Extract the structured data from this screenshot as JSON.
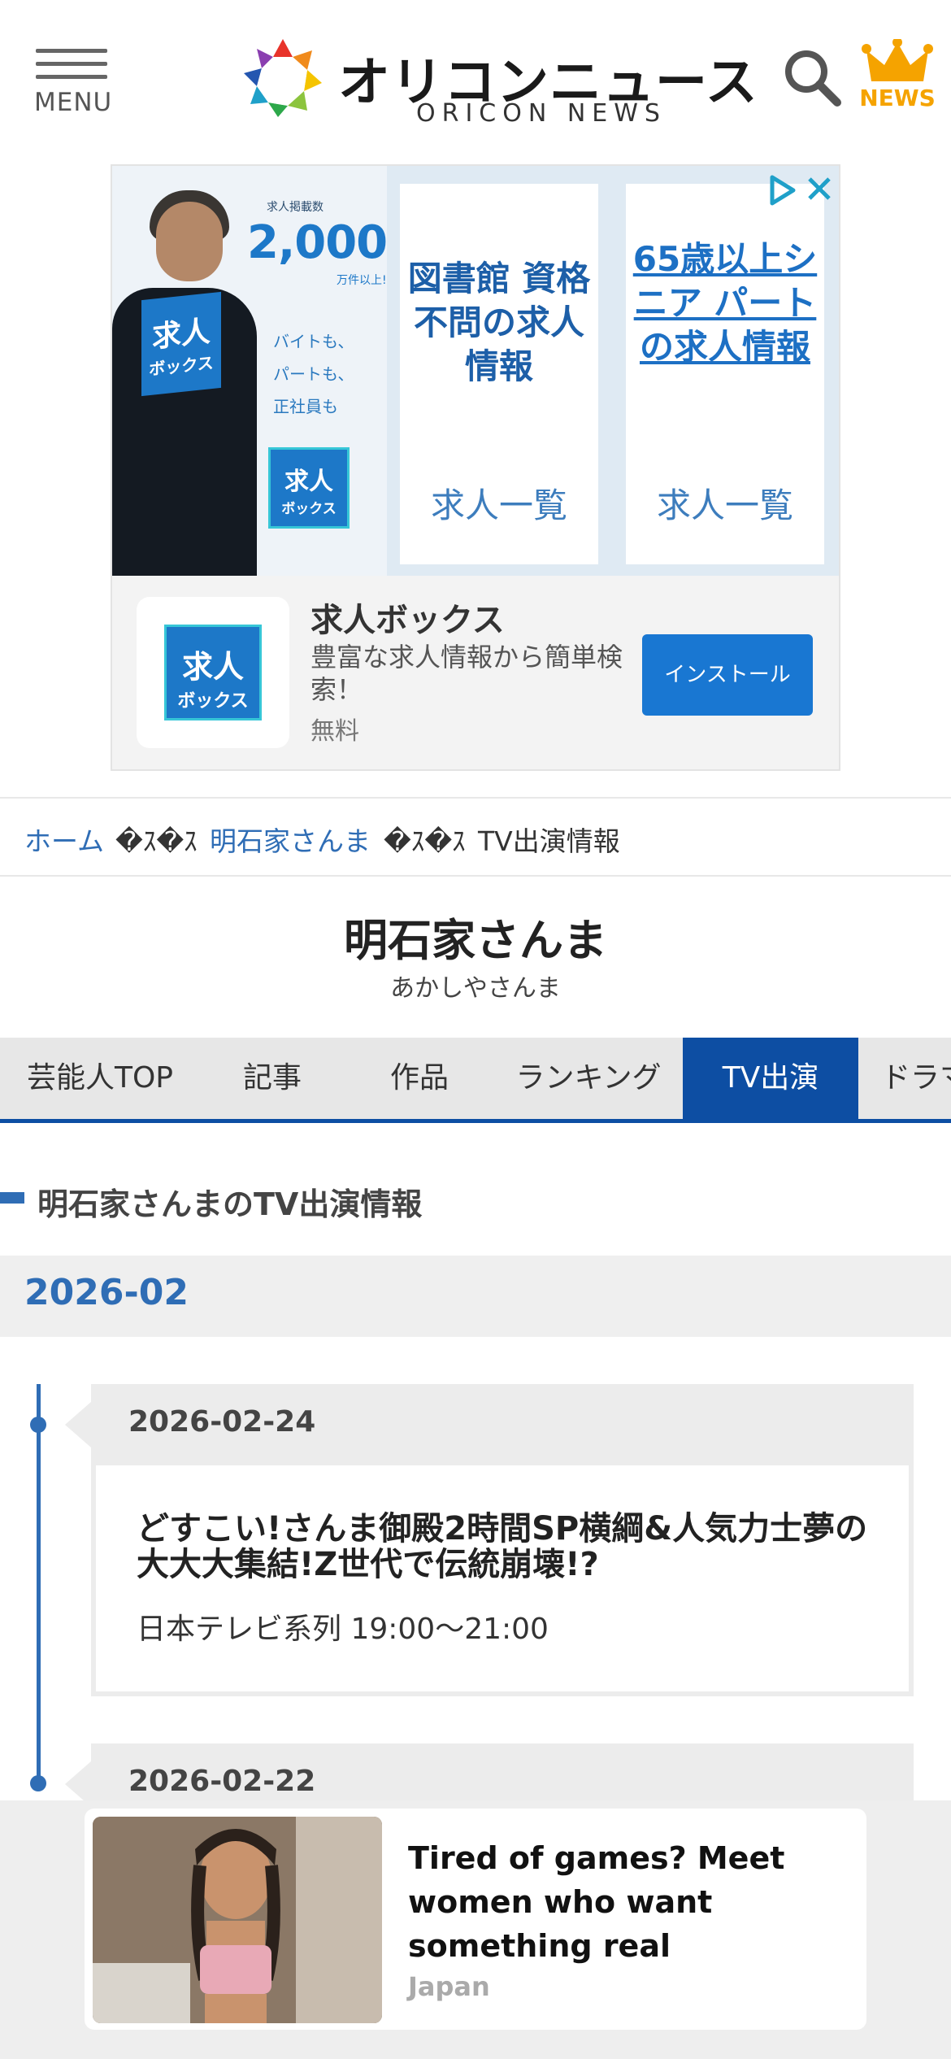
{
  "header": {
    "menu_label": "MENU",
    "logo_text": "オリコンニュース",
    "logo_subtext": "ORICON NEWS",
    "news_label": "NEWS"
  },
  "ad": {
    "count_label": "求人掲載数",
    "count": "2,000",
    "count_unit": "万件以上!",
    "bullets": [
      "バイトも、",
      "パートも、",
      "正社員も"
    ],
    "box_text": "求人\nボックス",
    "card1_head": "図書館 資格不問の求人情報",
    "card1_foot": "求人一覧",
    "card2_head": "65歳以上シニア パートの求人情報",
    "card2_foot": "求人一覧",
    "app_name": "求人ボックス",
    "app_desc": "豊富な求人情報から簡単検索！",
    "app_price": "無料",
    "install_label": "インストール"
  },
  "breadcrumb": {
    "home": "ホーム",
    "sep": "�ｽ�ｽ",
    "artist": "明石家さんま",
    "current": "TV出演情報"
  },
  "profile": {
    "name": "明石家さんま",
    "kana": "あかしやさんま"
  },
  "tabs": [
    "芸能人TOP",
    "記事",
    "作品",
    "ランキング",
    "TV出演",
    "ドラマ"
  ],
  "active_tab": "TV出演",
  "section": {
    "title": "明石家さんまのTV出演情報",
    "month": "2026-02"
  },
  "entries": [
    {
      "date": "2026-02-24",
      "title": "どすこい!さんま御殿2時間SP横綱&人気力士夢の大大大集結!Z世代で伝統崩壊!?",
      "info": "日本テレビ系列 19:00〜21:00"
    },
    {
      "date": "2026-02-22"
    }
  ],
  "sticky_ad": {
    "title": "Tired of games? Meet women who want something real",
    "source": "Japan"
  },
  "colors": {
    "brand_blue": "#0d4ea3",
    "link_blue": "#2f6db5",
    "news_orange": "#f5a300"
  },
  "icons": [
    "hamburger-icon",
    "search-icon",
    "crown-icon",
    "adchoices-icon",
    "close-icon"
  ]
}
